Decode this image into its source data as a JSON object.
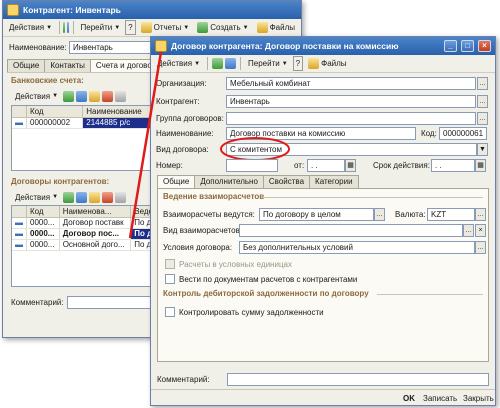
{
  "back_window": {
    "title": "Контрагент: Инвентарь",
    "toolbar": {
      "actions": "Действия",
      "go": "Перейти",
      "help": "?",
      "reports": "Отчеты",
      "create": "Создать",
      "files": "Файлы"
    },
    "name_label": "Наименование:",
    "name_value": "Инвентарь",
    "tabs": [
      "Общие",
      "Контакты",
      "Счета и договоры"
    ],
    "bank_section": "Банковские счета:",
    "bank_toolbar": "Действия",
    "bank_table": {
      "columns": [
        "Код",
        "Наименование"
      ],
      "rows": [
        [
          "000000002",
          "2144885 р/с"
        ]
      ]
    },
    "contracts_section": "Договоры контрагентов:",
    "contracts_toolbar": "Действия",
    "contracts_table": {
      "columns": [
        "Код",
        "Наименова...",
        "Веде"
      ],
      "rows": [
        [
          "0000...",
          "Договор поставк",
          "По д"
        ],
        [
          "0000...",
          "Договор пос...",
          "По д"
        ],
        [
          "0000...",
          "Основной дого...",
          "По д"
        ]
      ]
    },
    "comment_label": "Комментарий:"
  },
  "front_window": {
    "title": "Договор контрагента: Договор поставки на комиссию",
    "toolbar": {
      "actions": "Действия",
      "go": "Перейти",
      "help": "?",
      "files": "Файлы"
    },
    "org_label": "Организация:",
    "org_value": "Мебельный комбинат",
    "contractor_label": "Контрагент:",
    "contractor_value": "Инвентарь",
    "group_label": "Группа договоров:",
    "group_value": "",
    "name_label": "Наименование:",
    "name_value": "Договор поставки на комиссию",
    "code_label": "Код:",
    "code_value": "000000061",
    "type_label": "Вид договора:",
    "type_value": "С комитентом",
    "number_label": "Номер:",
    "number_value": "",
    "from_label": "от:",
    "from_value": ". .",
    "validity_label": "Срок действия:",
    "validity_value": ". .",
    "tabs": [
      "Общие",
      "Дополнительно",
      "Свойства",
      "Категории"
    ],
    "settlement_section": "Ведение взаиморасчетов",
    "settlement_label": "Взаиморасчеты ведутся:",
    "settlement_value": "По договору в целом",
    "currency_label": "Валюта:",
    "currency_value": "KZT",
    "settlement_kind_label": "Вид взаиморасчетов:",
    "settlement_kind_value": "",
    "conditions_label": "Условия договора:",
    "conditions_value": "Без дополнительных условий",
    "check_units": "Расчеты в условных единицах",
    "check_docs": "Вести по документам расчетов с контрагентами",
    "control_section": "Контроль дебиторской задолженности по договору",
    "check_control": "Контролировать сумму задолженности",
    "comment_label": "Комментарий:",
    "comment_value": "",
    "buttons": {
      "ok": "OK",
      "write": "Записать",
      "close": "Закрыть"
    }
  },
  "annotation_color": "#e01b1b"
}
